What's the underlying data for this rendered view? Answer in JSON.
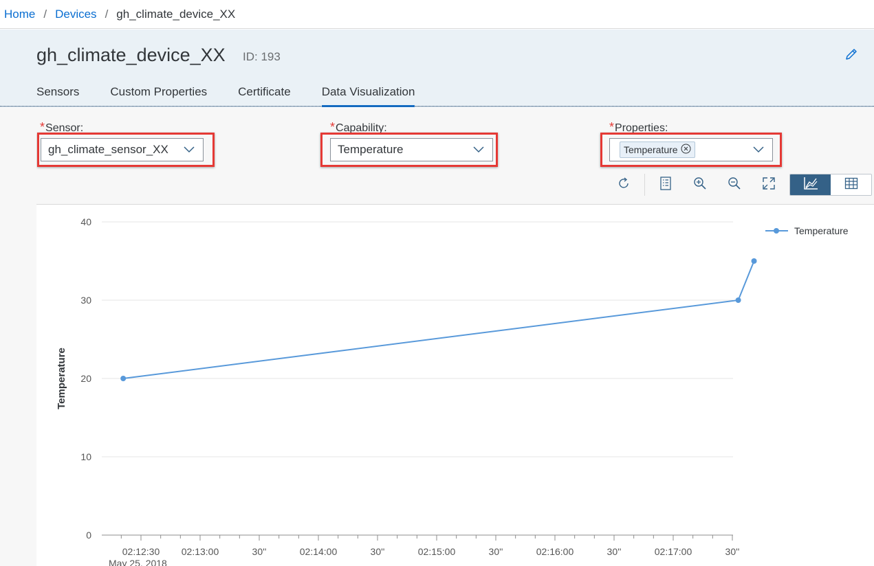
{
  "breadcrumb": {
    "home": "Home",
    "devices": "Devices",
    "current": "gh_climate_device_XX",
    "separator": "/"
  },
  "header": {
    "title": "gh_climate_device_XX",
    "id_label": "ID: 193",
    "edit_icon": "pencil-icon"
  },
  "tabs": [
    {
      "label": "Sensors",
      "active": false
    },
    {
      "label": "Custom Properties",
      "active": false
    },
    {
      "label": "Certificate",
      "active": false
    },
    {
      "label": "Data Visualization",
      "active": true
    }
  ],
  "filters": {
    "required_mark": "*",
    "sensor": {
      "label": "Sensor:",
      "value": "gh_climate_sensor_XX"
    },
    "capability": {
      "label": "Capability:",
      "value": "Temperature"
    },
    "properties": {
      "label": "Properties:",
      "token": "Temperature"
    }
  },
  "toolbar": {
    "icons": [
      "refresh-icon",
      "legend-list-icon",
      "zoom-in-icon",
      "zoom-out-icon",
      "fullscreen-icon"
    ],
    "view_toggle": [
      {
        "icon": "line-chart-icon",
        "active": true
      },
      {
        "icon": "table-icon",
        "active": false
      }
    ]
  },
  "colors": {
    "accent": "#0a6ed1",
    "series": "#5899da",
    "highlight_box": "#e53935",
    "toggle_active": "#346187"
  },
  "chart_data": {
    "type": "line",
    "title": "",
    "xlabel": "",
    "ylabel": "Temperature",
    "ylim": [
      0,
      40
    ],
    "y_ticks": [
      0,
      10,
      20,
      30,
      40
    ],
    "x_ticks": [
      "02:12:30",
      "02:13:00",
      "30''",
      "02:14:00",
      "30''",
      "02:15:00",
      "30''",
      "02:16:00",
      "30''",
      "02:17:00",
      "30''"
    ],
    "x_date_label": "May 25, 2018",
    "grid": true,
    "legend_position": "top-right",
    "series": [
      {
        "name": "Temperature",
        "x": [
          "02:12:21",
          "02:17:33",
          "02:17:41"
        ],
        "values": [
          20,
          30,
          35
        ]
      }
    ]
  }
}
